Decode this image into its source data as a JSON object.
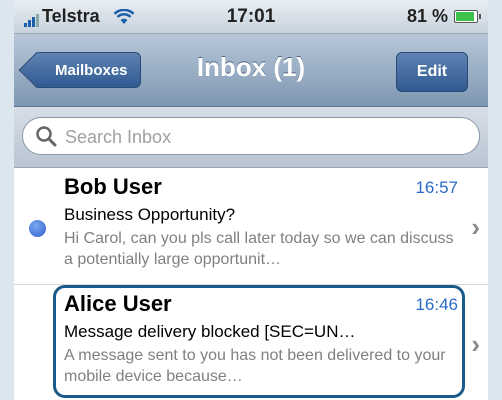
{
  "status_bar": {
    "carrier": "Telstra",
    "time": "17:01",
    "battery": "81 %"
  },
  "nav": {
    "back_label": "Mailboxes",
    "title": "Inbox (1)",
    "edit_label": "Edit"
  },
  "search": {
    "placeholder": "Search Inbox"
  },
  "messages": [
    {
      "from": "Bob User",
      "time": "16:57",
      "subject": "Business Opportunity?",
      "preview": "Hi Carol, can you pls call later today so we can discuss a potentially large opportunit…",
      "unread": true
    },
    {
      "from": "Alice User",
      "time": "16:46",
      "subject": "Message delivery blocked [SEC=UN…",
      "preview": "A message sent to you has not been delivered to your mobile device because…",
      "unread": false
    }
  ],
  "colors": {
    "accent": "#2a6bc7",
    "nav_button": "#2f5a91",
    "highlight_border": "#1a5a8a"
  }
}
